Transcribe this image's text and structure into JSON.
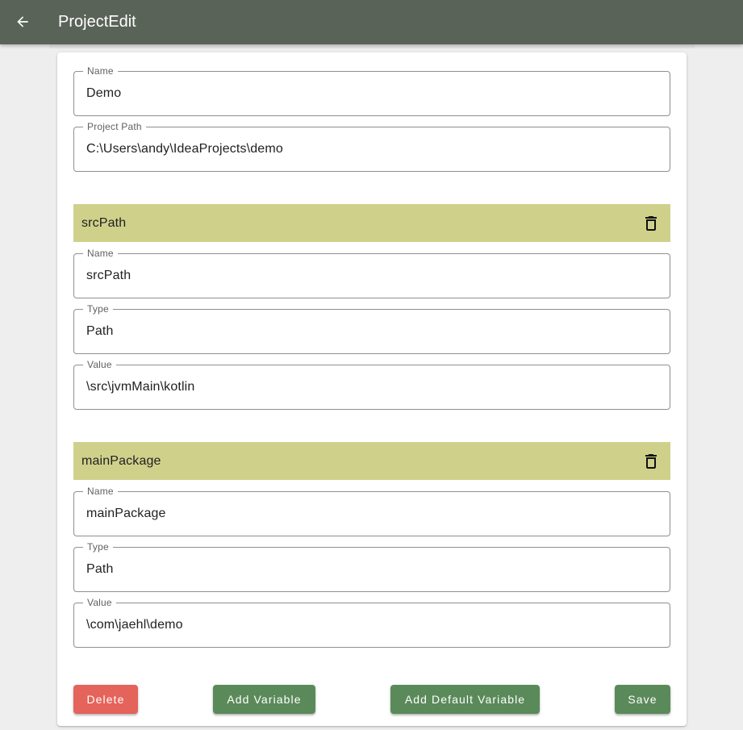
{
  "appbar": {
    "title": "ProjectEdit",
    "back_icon": "arrow-left-icon",
    "background": "#5a6358"
  },
  "project": {
    "name_label": "Name",
    "name_value": "Demo",
    "path_label": "Project Path",
    "path_value": "C:\\Users\\andy\\IdeaProjects\\demo"
  },
  "variables": [
    {
      "title": "srcPath",
      "delete_icon": "trash-icon",
      "name_label": "Name",
      "name_value": "srcPath",
      "type_label": "Type",
      "type_value": "Path",
      "value_label": "Value",
      "value_value": "\\src\\jvmMain\\kotlin"
    },
    {
      "title": "mainPackage",
      "delete_icon": "trash-icon",
      "name_label": "Name",
      "name_value": "mainPackage",
      "type_label": "Type",
      "type_value": "Path",
      "value_label": "Value",
      "value_value": "\\com\\jaehl\\demo"
    }
  ],
  "actions": {
    "delete_label": "Delete",
    "add_variable_label": "Add Variable",
    "add_default_variable_label": "Add Default Variable",
    "save_label": "Save"
  },
  "colors": {
    "primary": "#5b8a5a",
    "danger": "#e4635a",
    "variable_header": "#cfd18b"
  }
}
